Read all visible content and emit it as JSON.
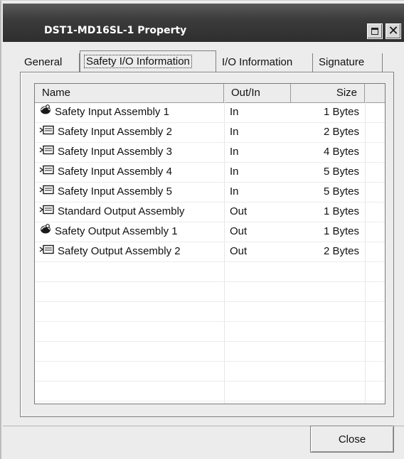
{
  "window": {
    "title": "DST1-MD16SL-1 Property",
    "close_glyph": "✕"
  },
  "tabs": [
    {
      "label": "General",
      "active": false
    },
    {
      "label": "Safety I/O Information",
      "active": true
    },
    {
      "label": "I/O Information",
      "active": false
    },
    {
      "label": "Signature",
      "active": false
    }
  ],
  "table": {
    "columns": [
      "Name",
      "Out/In",
      "Size"
    ],
    "rows": [
      {
        "icon": "safety-assembly-icon",
        "name": "Safety Input Assembly 1",
        "dir": "In",
        "size": "1 Bytes"
      },
      {
        "icon": "input-assembly-icon",
        "name": "Safety Input Assembly 2",
        "dir": "In",
        "size": "2 Bytes"
      },
      {
        "icon": "input-assembly-icon",
        "name": "Safety Input Assembly 3",
        "dir": "In",
        "size": "4 Bytes"
      },
      {
        "icon": "input-assembly-icon",
        "name": "Safety Input Assembly 4",
        "dir": "In",
        "size": "5 Bytes"
      },
      {
        "icon": "input-assembly-icon",
        "name": "Safety Input Assembly 5",
        "dir": "In",
        "size": "5 Bytes"
      },
      {
        "icon": "input-assembly-icon",
        "name": "Standard Output Assembly",
        "dir": "Out",
        "size": "1 Bytes"
      },
      {
        "icon": "safety-assembly-icon",
        "name": "Safety Output Assembly 1",
        "dir": "Out",
        "size": "1 Bytes"
      },
      {
        "icon": "input-assembly-icon",
        "name": "Safety Output Assembly 2",
        "dir": "Out",
        "size": "2 Bytes"
      }
    ]
  },
  "buttons": {
    "close_label": "Close"
  }
}
